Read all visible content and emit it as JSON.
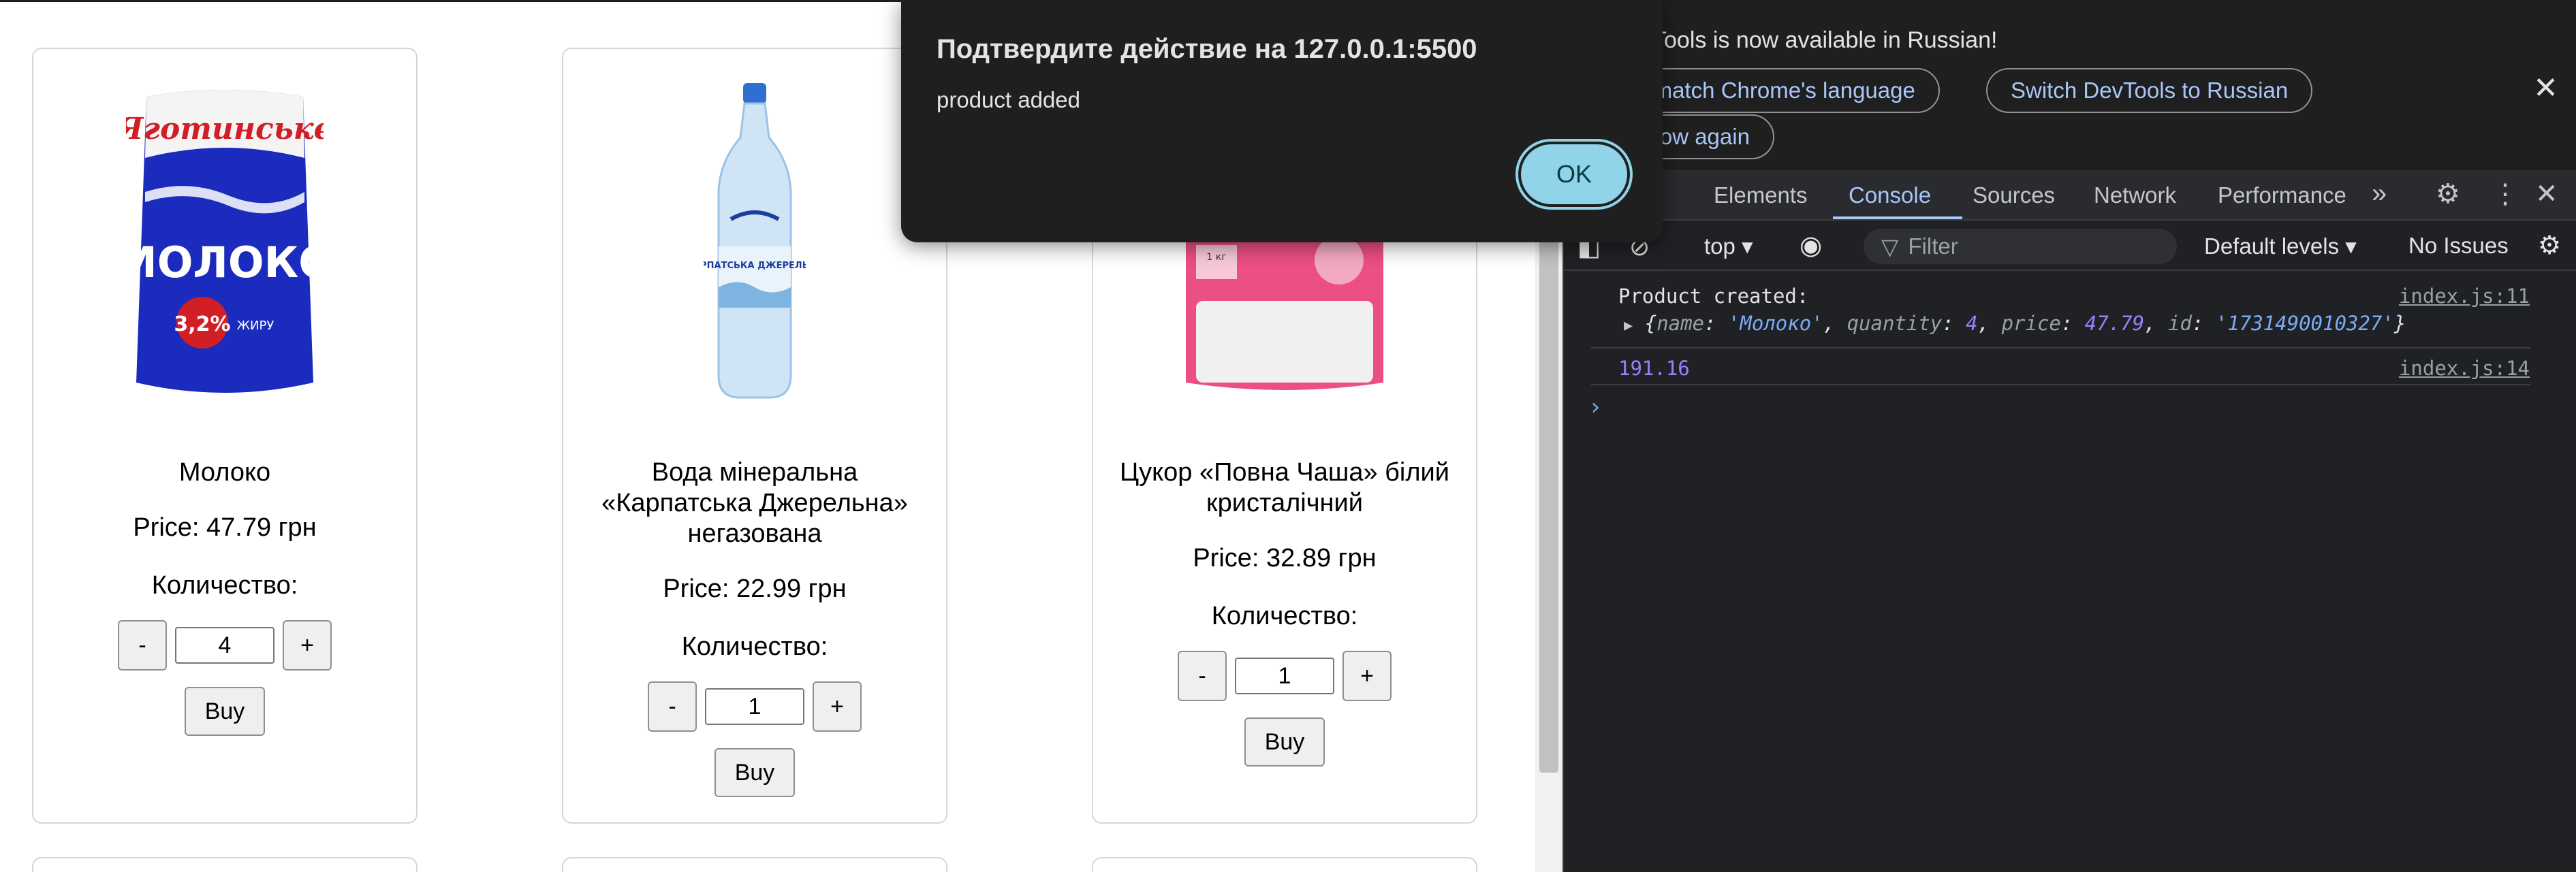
{
  "products": [
    {
      "name": "Молоко",
      "price_text": "Price: 47.79 грн",
      "qty_label": "Количество:",
      "qty": "4",
      "minus": "-",
      "plus": "+",
      "buy": "Buy"
    },
    {
      "name": "Вода мінеральна «Карпатська Джерельна» негазована",
      "price_text": "Price: 22.99 грн",
      "qty_label": "Количество:",
      "qty": "1",
      "minus": "-",
      "plus": "+",
      "buy": "Buy"
    },
    {
      "name": "Цукор «Повна Чаша» білий кристалічний",
      "price_text": "Price: 32.89 грн",
      "qty_label": "Количество:",
      "qty": "1",
      "minus": "-",
      "plus": "+",
      "buy": "Buy"
    }
  ],
  "product_images": {
    "milk": {
      "brand": "Яготинське",
      "label": "МОЛОКО",
      "fat": "3,2%",
      "fat_suffix": "ЖИРУ"
    },
    "water": {
      "label": "КАРПАТСЬКА ДЖЕРЕЛЬНА"
    },
    "sugar": {
      "label": "1 кг"
    }
  },
  "dialog": {
    "title": "Подтвердите действие на 127.0.0.1:5500",
    "message": "product added",
    "ok": "OK"
  },
  "devtools": {
    "infobar": {
      "text": "Tools is now available in Russian!",
      "btn_match": "s match Chrome's language",
      "btn_switch": "Switch DevTools to Russian",
      "btn_dont_show": "show again"
    },
    "tabs": [
      "Elements",
      "Console",
      "Sources",
      "Network",
      "Performance"
    ],
    "active_tab": "Console",
    "toolbar": {
      "context": "top",
      "filter_placeholder": "Filter",
      "levels": "Default levels",
      "issues": "No Issues"
    },
    "console": [
      {
        "text": "Product created:",
        "source": "index.js:11"
      },
      {
        "text": "191.16",
        "source": "index.js:14"
      }
    ],
    "object_preview": {
      "name_key": "name",
      "name_val": "'Молоко'",
      "qty_key": "quantity",
      "qty_val": "4",
      "price_key": "price",
      "price_val": "47.79",
      "id_key": "id",
      "id_val": "'1731490010327'"
    }
  },
  "colors": {
    "ok_button": "#8fd4e8",
    "active_tab": "#a8c7fa",
    "number_output": "#9980ff"
  }
}
